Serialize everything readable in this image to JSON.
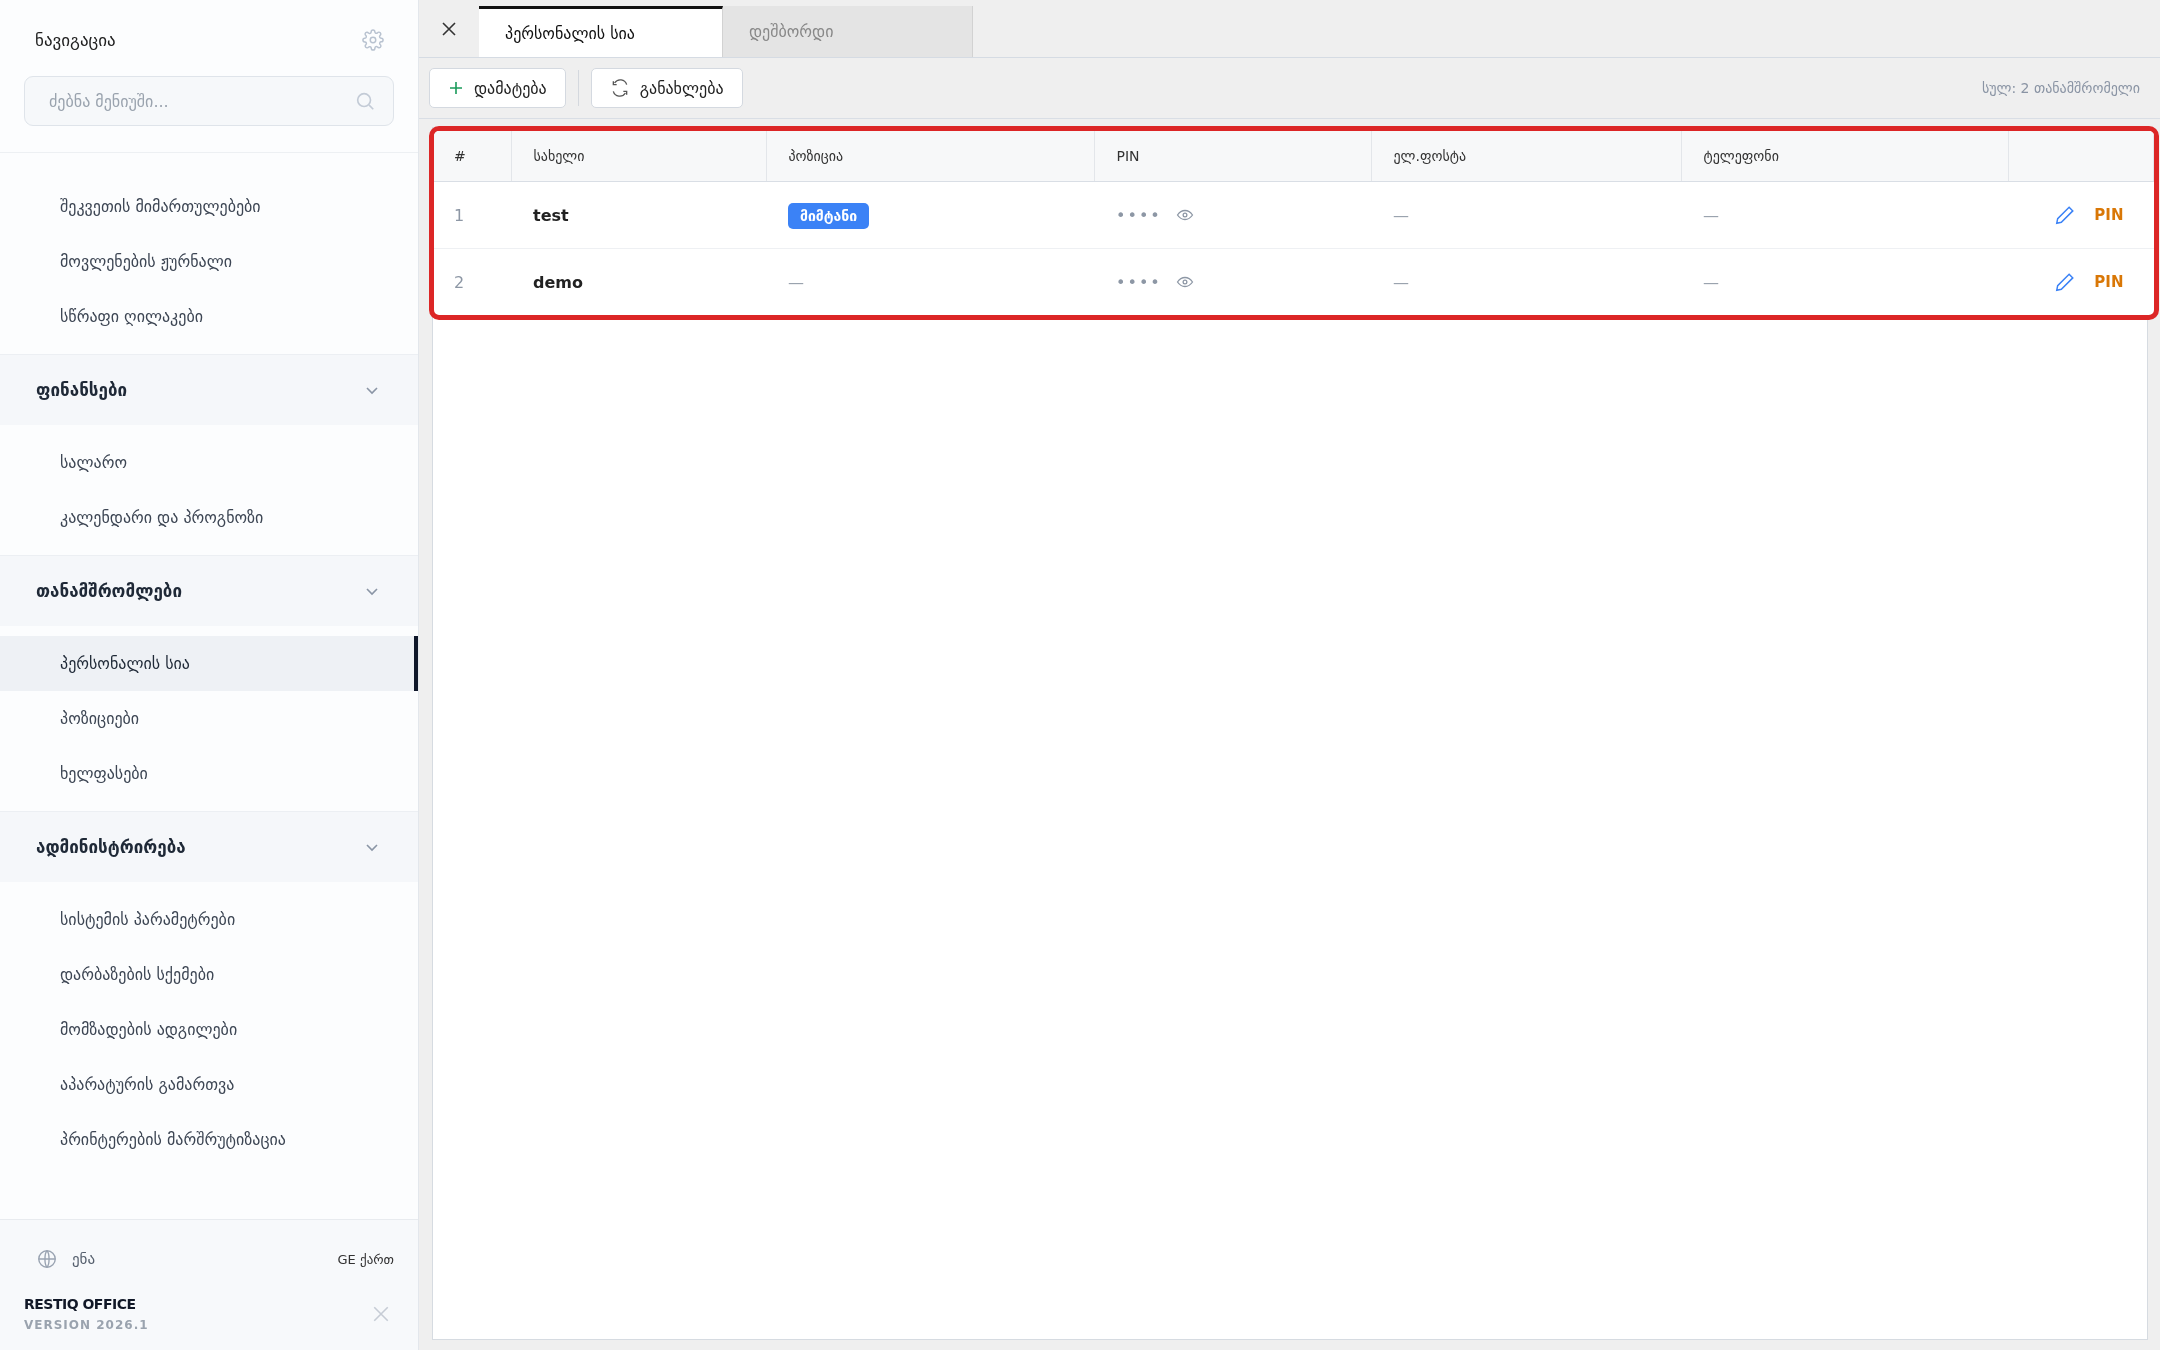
{
  "sidebar": {
    "title": "ნავიგაცია",
    "search": {
      "placeholder": "ძებნა მენიუში..."
    },
    "sections": [
      {
        "items": [
          {
            "label": "შეკვეთის მიმართულებები",
            "selected": false
          },
          {
            "label": "მოვლენების ჟურნალი",
            "selected": false
          },
          {
            "label": "სწრაფი ღილაკები",
            "selected": false
          }
        ]
      },
      {
        "title": "ფინანსები",
        "expanded": true,
        "items": [
          {
            "label": "სალარო",
            "selected": false
          },
          {
            "label": "კალენდარი და პროგნოზი",
            "selected": false
          }
        ]
      },
      {
        "title": "თანამშრომლები",
        "expanded": true,
        "items": [
          {
            "label": "პერსონალის სია",
            "selected": true
          },
          {
            "label": "პოზიციები",
            "selected": false
          },
          {
            "label": "ხელფასები",
            "selected": false
          }
        ]
      },
      {
        "title": "ადმინისტრირება",
        "expanded": true,
        "items": [
          {
            "label": "სისტემის პარამეტრები",
            "selected": false
          },
          {
            "label": "დარბაზების სქემები",
            "selected": false
          },
          {
            "label": "მომზადების ადგილები",
            "selected": false
          },
          {
            "label": "აპარატურის გამართვა",
            "selected": false
          },
          {
            "label": "პრინტერების მარშრუტიზაცია",
            "selected": false
          }
        ]
      }
    ],
    "language": {
      "label": "ენა",
      "value": "GE ქართ"
    },
    "brand": "RESTIQ OFFICE",
    "version": "VERSION 2026.1"
  },
  "tabs": [
    {
      "label": "პერსონალის სია",
      "selected": true
    },
    {
      "label": "დეშბორდი",
      "selected": false
    }
  ],
  "toolbar": {
    "buttons": [
      {
        "kind": "add",
        "label": "დამატება"
      },
      {
        "kind": "refresh",
        "label": "განახლება"
      }
    ],
    "total": "სულ: 2 თანამშრომელი"
  },
  "table": {
    "columns": [
      "#",
      "სახელი",
      "პოზიცია",
      "PIN",
      "ელ.ფოსტა",
      "ტელეფონი"
    ],
    "rows": [
      {
        "index": "1",
        "name": "test",
        "position": {
          "kind": "badge",
          "text": "მიმტანი"
        },
        "pin": "••••",
        "email": "—",
        "phone": "—",
        "action": "PIN"
      },
      {
        "index": "2",
        "name": "demo",
        "position": {
          "kind": "text",
          "text": "—"
        },
        "pin": "••••",
        "email": "—",
        "phone": "—",
        "action": "PIN"
      }
    ]
  }
}
